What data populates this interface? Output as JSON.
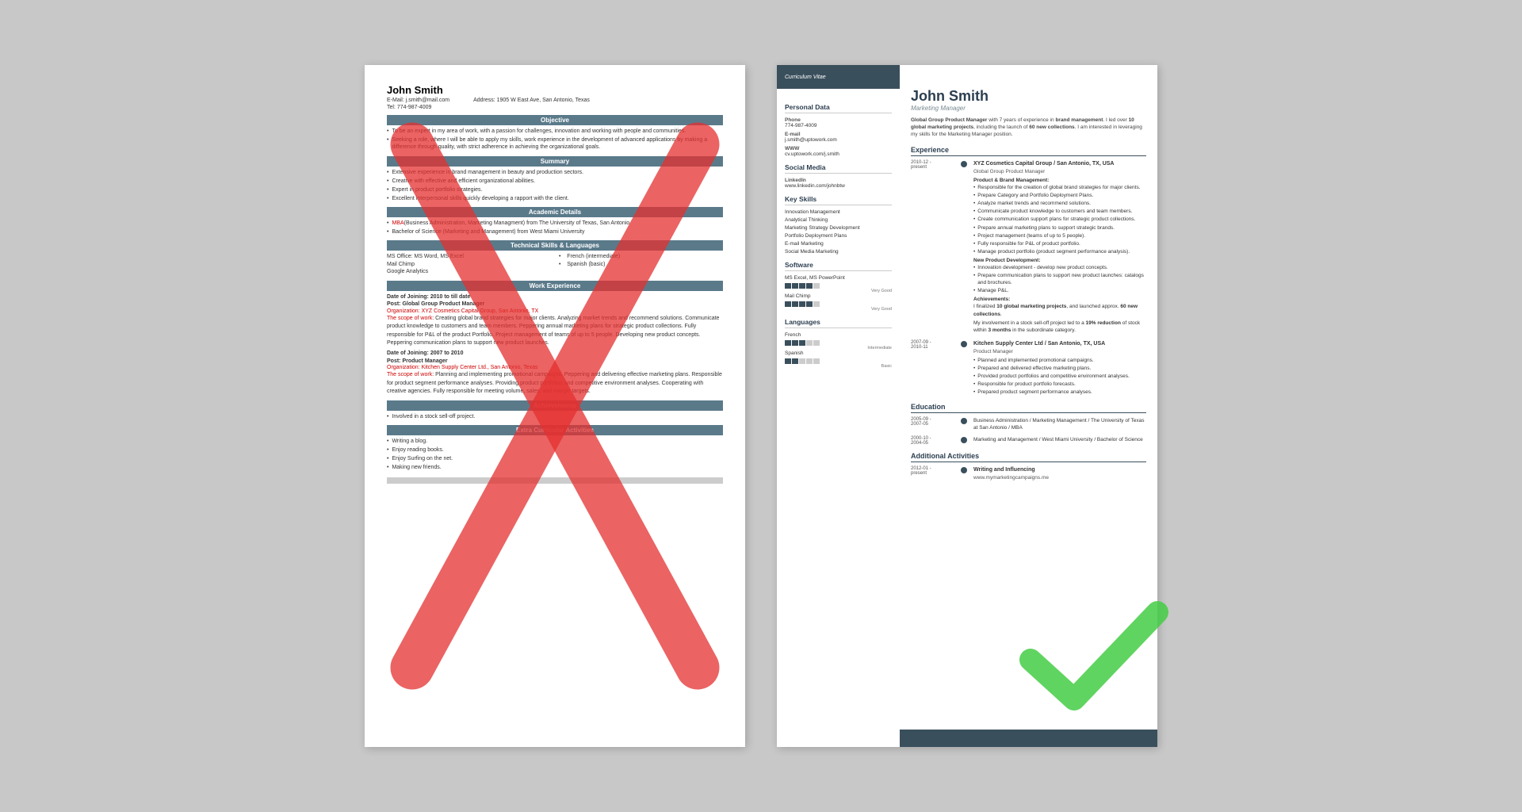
{
  "left_resume": {
    "name": "John Smith",
    "email": "E-Mail: j.smith@mail.com",
    "tel": "Tel: 774-987-4009",
    "address": "Address: 1905 W East Ave, San Antonio, Texas",
    "sections": {
      "objective": "Objective",
      "objective_bullets": [
        "To be an expert in my area of work, with a passion for challenges, innovation and working with people and communities.",
        "Seeking a role, where I will be able to apply my skills, work experience in the development of advanced applications by making a difference through quality, with strict adherence in achieving the organizational goals."
      ],
      "summary": "Summary",
      "summary_bullets": [
        "Extensive experience in brand management in beauty and production sectors.",
        "Creative with effective and efficient organizational abilities.",
        "Expert in product portfolio strategies.",
        "Excellent interpersonal skills quickly developing a rapport with the client."
      ],
      "academic": "Academic Details",
      "academic_bullets": [
        "MBA (Business Administration, Marketing Managment) from The University of Texas, San Antonio",
        "Bachelor of Science (Marketing and Management) from West Miami University"
      ],
      "technical": "Technical Skills & Languages",
      "skills_col1": [
        "MS Office: MS Word, MS Excel",
        "Mail Chimp",
        "Google Analytics"
      ],
      "skills_col2": [
        "French (intermediate)",
        "Spanish (basic)"
      ],
      "work": "Work Experience",
      "work_entries": [
        {
          "joining": "Date of Joining: 2010 to till date",
          "post": "Post: Global Group Product Manager",
          "org": "Organization: XYZ Cosmetics Capital Group, San Antonio, TX",
          "scope": "The scope of work: Creating global brand strategies for major clients. Analyzing market trends and recommend solutions. Communicate product knowledge to customers and team members. Peppering annual marketing plans for strategic product collections. Fully responsible for P&L of the product Portfolio. Project management of teams of up to 5 people. Developing new product concepts. Peppering communication plans to support new product launches."
        },
        {
          "joining": "Date of Joining: 2007 to 2010",
          "post": "Post: Product Manager",
          "org": "Organization: Kitchen Supply Center Ltd., San Antonio, Texas",
          "scope": "The scope of work: Planning and implementing promotional campaigns. Peppering and delivering effective marketing plans. Responsible for product segment performance analyses. Providing product portfolios and competitive environment analyses. Cooperating with creative agencies. Fully responsible for meeting volume, sales, and margin targets."
        }
      ],
      "achievements": "Achievements",
      "achievements_bullets": [
        "Involved in a stock sell-off project."
      ],
      "extracurricular": "Extra Curricular Activities",
      "extracurricular_bullets": [
        "Writing a blog.",
        "Enjoy reading books.",
        "Enjoy Surfing on the net.",
        "Making new friends."
      ]
    }
  },
  "right_resume": {
    "cv_label": "Curriculum Vitae",
    "name": "John Smith",
    "title": "Marketing Manager",
    "intro": "Global Group Product Manager with 7 years of experience in brand management. I led over 10 global marketing projects, including the launch of 60 new collections. I am interested in leveraging my skills for the Marketing Manager position.",
    "sidebar": {
      "personal_data": "Personal Data",
      "phone_label": "Phone",
      "phone": "774-987-4009",
      "email_label": "E-mail",
      "email": "j.smith@uptowork.com",
      "www_label": "WWW",
      "www": "cv.uptowork.com/j.smith",
      "social_media": "Social Media",
      "linkedin_label": "LinkedIn",
      "linkedin": "www.linkedin.com/johnbtw",
      "key_skills": "Key Skills",
      "skills": [
        "Innovation Management",
        "Analytical Thinking",
        "Marketing Strategy Development",
        "Portfolio Deployment Plans",
        "E-mail Marketing",
        "Social Media Marketing"
      ],
      "software": "Software",
      "software_items": [
        {
          "name": "MS Excel, MS PowerPoint",
          "level": "Very Good",
          "filled": 4,
          "total": 5
        },
        {
          "name": "Mail Chimp",
          "level": "Very Good",
          "filled": 4,
          "total": 5
        }
      ],
      "languages": "Languages",
      "language_items": [
        {
          "name": "French",
          "level": "Intermediate",
          "filled": 3,
          "total": 5
        },
        {
          "name": "Spanish",
          "level": "Basic",
          "filled": 2,
          "total": 5
        }
      ]
    },
    "experience": "Experience",
    "exp_entries": [
      {
        "dates": "2010-12 - present",
        "company": "XYZ Cosmetics Capital Group / San Antonio, TX, USA",
        "role": "Global Group Product Manager",
        "subsection1": "Product & Brand Management:",
        "bullets1": [
          "Responsible for the creation of global brand strategies for major clients.",
          "Prepare Category and Portfolio Deployment Plans.",
          "Analyze market trends and recommend solutions.",
          "Communicate product knowledge to customers and team members.",
          "Create communication support plans for strategic product collections.",
          "Prepare annual marketing plans to support strategic brands.",
          "Project management (teams of up to 5 people).",
          "Fully responsible for P&L of product portfolio.",
          "Manage product portfolio (product segment performance analysis)."
        ],
        "subsection2": "New Product Development:",
        "bullets2": [
          "Innovation development - develop new product concepts.",
          "Prepare communication plans to support new product launches: catalogs and brochures.",
          "Manage P&L."
        ],
        "subsection3": "Achievements:",
        "bullets3": [
          "I finalized 10 global marketing projects, and launched approx. 60 new collections.",
          "My involvement in a stock sell-off project led to a 19% reduction of stock within 3 months in the subordinate category."
        ]
      },
      {
        "dates": "2007-09 - 2010-11",
        "company": "Kitchen Supply Center Ltd / San Antonio, TX, USA",
        "role": "Product Manager",
        "bullets1": [
          "Planned and implemented promotional campaigns.",
          "Prepared and delivered effective marketing plans.",
          "Provided product portfolios and competitive environment analyses.",
          "Responsible for product portfolio forecasts.",
          "Prepared product segment performance analyses."
        ]
      }
    ],
    "education": "Education",
    "edu_entries": [
      {
        "dates": "2005-09 - 2007-05",
        "detail": "Business Administration / Marketing Management / The University of Texas at San Antonio / MBA"
      },
      {
        "dates": "2000-10 - 2004-05",
        "detail": "Marketing and Management / West Miami University / Bachelor of Science"
      }
    ],
    "additional": "Additional Activities",
    "additional_entries": [
      {
        "dates": "2012-01 - present",
        "title": "Writing and Influencing",
        "detail": "www.mymarketingcampaigns.me"
      }
    ]
  }
}
